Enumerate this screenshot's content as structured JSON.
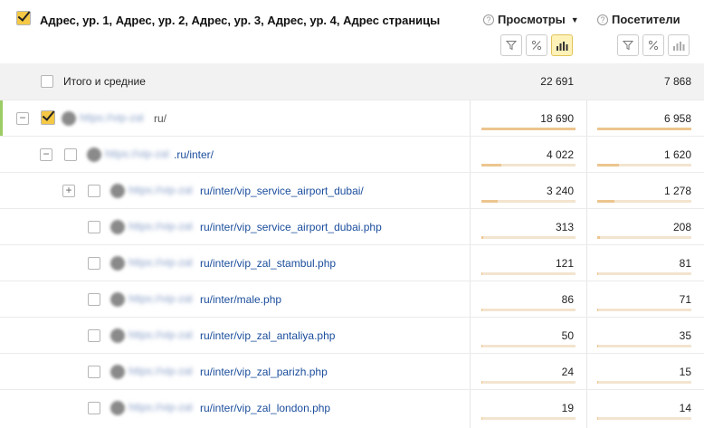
{
  "header": {
    "dimension_title": "Адрес, ур. 1, Адрес, ур. 2, Адрес, ур. 3, Адрес, ур. 4, Адрес страницы",
    "metrics": [
      {
        "label": "Просмотры",
        "sorted": true,
        "sort_arrow": "▼"
      },
      {
        "label": "Посетители",
        "sorted": false
      }
    ],
    "metric_buttons": [
      "filter-icon",
      "percent-icon",
      "bar-chart-icon"
    ]
  },
  "total": {
    "label": "Итого и средние",
    "views": "22 691",
    "visitors": "7 868"
  },
  "rows": [
    {
      "level": 1,
      "toggle": "−",
      "checked": true,
      "url_suffix": "ru/",
      "views": "18 690",
      "visitors": "6 958",
      "views_share": 1.0,
      "visitors_share": 1.0
    },
    {
      "level": 2,
      "toggle": "−",
      "checked": false,
      "url_suffix": ".ru/inter/",
      "views": "4 022",
      "visitors": "1 620",
      "views_share": 0.21,
      "visitors_share": 0.23
    },
    {
      "level": 3,
      "toggle": "+",
      "checked": false,
      "url_suffix": "ru/inter/vip_service_airport_dubai/",
      "views": "3 240",
      "visitors": "1 278",
      "views_share": 0.17,
      "visitors_share": 0.18
    },
    {
      "level": 4,
      "toggle": "",
      "checked": false,
      "url_suffix": "ru/inter/vip_service_airport_dubai.php",
      "views": "313",
      "visitors": "208",
      "views_share": 0.02,
      "visitors_share": 0.03
    },
    {
      "level": 4,
      "toggle": "",
      "checked": false,
      "url_suffix": "ru/inter/vip_zal_stambul.php",
      "views": "121",
      "visitors": "81",
      "views_share": 0.01,
      "visitors_share": 0.01
    },
    {
      "level": 4,
      "toggle": "",
      "checked": false,
      "url_suffix": "ru/inter/male.php",
      "views": "86",
      "visitors": "71",
      "views_share": 0.005,
      "visitors_share": 0.01
    },
    {
      "level": 4,
      "toggle": "",
      "checked": false,
      "url_suffix": "ru/inter/vip_zal_antaliya.php",
      "views": "50",
      "visitors": "35",
      "views_share": 0.003,
      "visitors_share": 0.005
    },
    {
      "level": 4,
      "toggle": "",
      "checked": false,
      "url_suffix": "ru/inter/vip_zal_parizh.php",
      "views": "24",
      "visitors": "15",
      "views_share": 0.001,
      "visitors_share": 0.002
    },
    {
      "level": 4,
      "toggle": "",
      "checked": false,
      "url_suffix": "ru/inter/vip_zal_london.php",
      "views": "19",
      "visitors": "14",
      "views_share": 0.001,
      "visitors_share": 0.002
    }
  ],
  "colors": {
    "accent_green": "#9ccc65",
    "checkbox_yellow": "#f5c945",
    "bar_fill": "#ecc58f",
    "bar_bg": "#f3e4cf",
    "link": "#1a4d9c"
  }
}
